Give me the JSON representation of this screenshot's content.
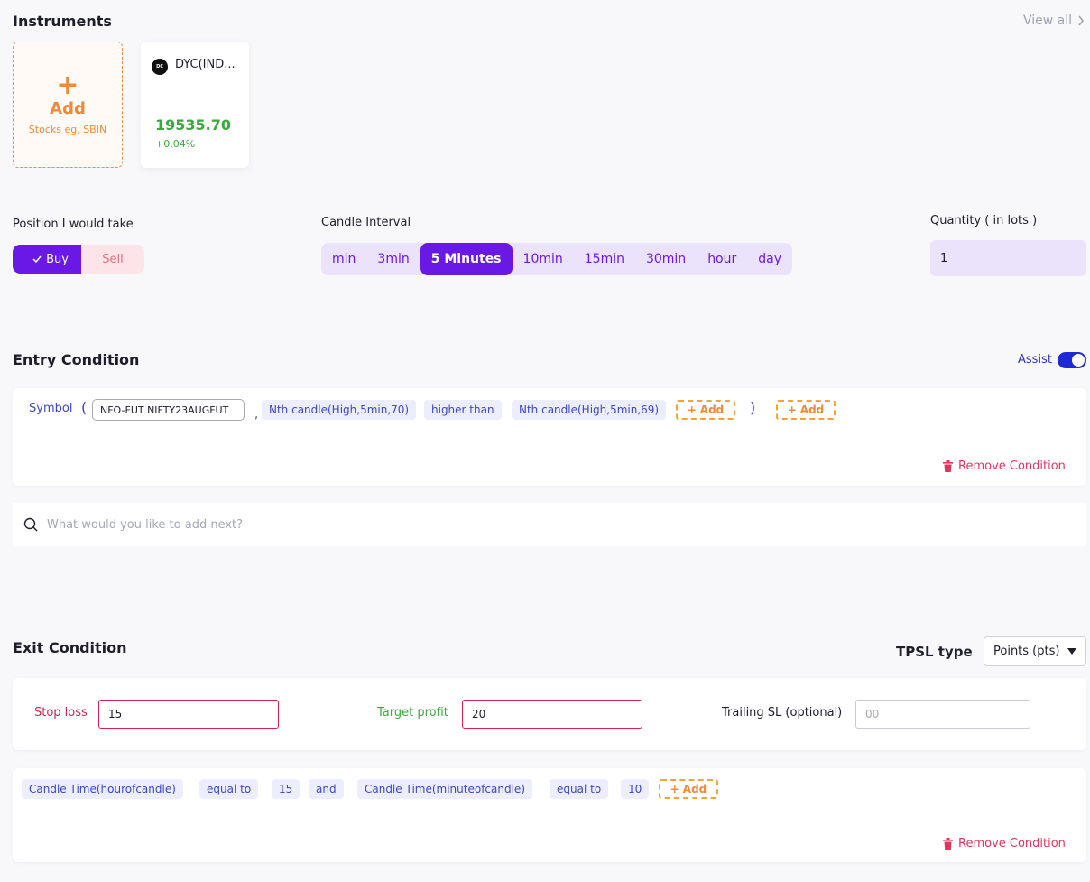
{
  "instruments": {
    "title": "Instruments",
    "view_all": "View all",
    "add_card": {
      "plus": "+",
      "label": "Add",
      "hint": "Stocks eg, SBIN"
    },
    "items": [
      {
        "logo_text": "DC",
        "name": "DYC(IND...",
        "price": "19535.70",
        "change": "+0.04%",
        "change_color": "#3aab3a"
      }
    ]
  },
  "position": {
    "label": "Position I would take",
    "buy": "Buy",
    "sell": "Sell",
    "selected": "Buy"
  },
  "candle_interval": {
    "label": "Candle Interval",
    "options": [
      "min",
      "3min",
      "5 Minutes",
      "10min",
      "15min",
      "30min",
      "hour",
      "day"
    ],
    "selected": "5 Minutes"
  },
  "quantity": {
    "label": "Quantity ( in lots )",
    "value": "1"
  },
  "entry": {
    "title": "Entry Condition",
    "assist_label": "Assist",
    "assist_on": true,
    "symbol_label": "Symbol",
    "open_paren": "(",
    "close_paren": ")",
    "comma": ",",
    "symbol_value": "NFO-FUT NIFTY23AUGFUT",
    "chips": [
      "Nth candle(High,5min,70)",
      "higher than",
      "Nth candle(High,5min,69)"
    ],
    "add_label": "Add",
    "remove_label": "Remove Condition",
    "search_placeholder": "What would you like to add next?"
  },
  "exit": {
    "title": "Exit Condition",
    "tpsl_label": "TPSL type",
    "tpsl_value": "Points (pts)",
    "stop_loss_label": "Stop loss",
    "stop_loss_value": "15",
    "target_label": "Target profit",
    "target_value": "20",
    "trailing_label": "Trailing SL (optional)",
    "trailing_placeholder": "00",
    "chips": [
      "Candle Time(hourofcandle)",
      "equal to",
      "15",
      "and",
      "Candle Time(minuteofcandle)",
      "equal to",
      "10"
    ],
    "add_label": "Add",
    "remove_label": "Remove Condition"
  },
  "colors": {
    "accent": "#6a18e6",
    "add_orange": "#f08a3a",
    "danger": "#e0365e",
    "positive": "#3aab3a",
    "chip_text": "#3c46c8"
  }
}
